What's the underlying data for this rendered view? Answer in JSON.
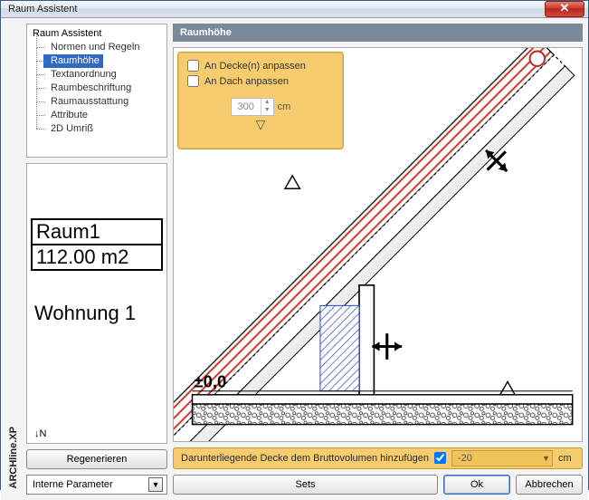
{
  "window": {
    "title": "Raum Assistent"
  },
  "app_label": "ARCHline.XP",
  "tree": {
    "root": "Raum Assistent",
    "items": [
      "Normen und Regeln",
      "Raumhöhe",
      "Textanordnung",
      "Raumbeschriftung",
      "Raumausstattung",
      "Attribute",
      "2D Umriß"
    ],
    "selected_index": 1
  },
  "preview": {
    "room_name": "Raum1",
    "area": "112.00 m2",
    "apartment": "Wohnung 1",
    "north": "N"
  },
  "buttons": {
    "regen": "Regenerieren",
    "sets": "Sets",
    "ok": "Ok",
    "cancel": "Abbrechen"
  },
  "subheader": "Raumhöhe",
  "options": {
    "fit_ceiling": "An Decke(n) anpassen",
    "fit_roof": "An Dach anpassen",
    "height_value": "300",
    "height_unit": "cm"
  },
  "footer": {
    "label": "Darunterliegende Decke dem Bruttovolumen hinzufügen",
    "checked": true,
    "value": "-20",
    "unit": "cm"
  },
  "bottom": {
    "select_label": "Interne Parameter"
  },
  "diagram": {
    "zero_label": "±0,0"
  }
}
